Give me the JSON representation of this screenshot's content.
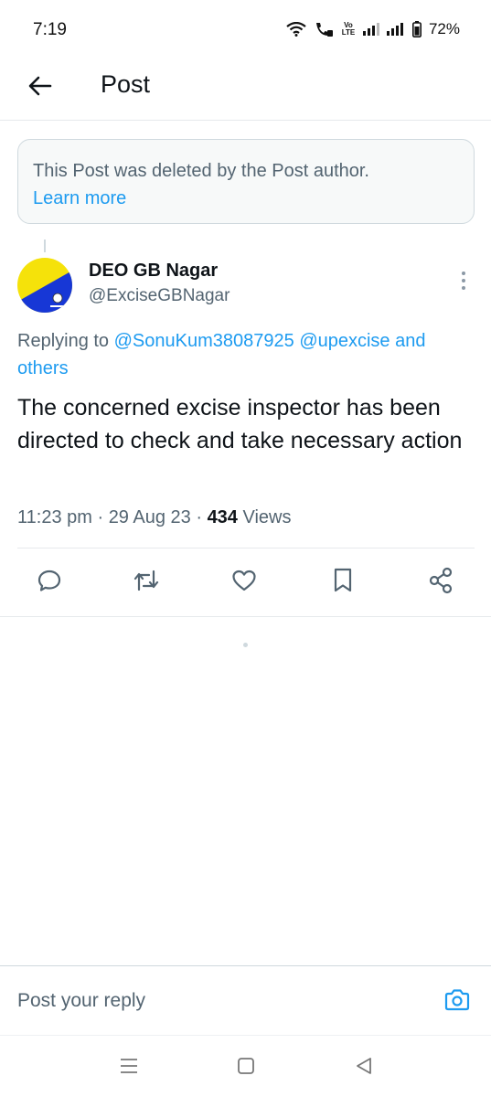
{
  "status_bar": {
    "time": "7:19",
    "volte_label": "Vo LTE",
    "battery": "72%"
  },
  "header": {
    "title": "Post"
  },
  "deleted_notice": {
    "message": "This Post was deleted by the Post author.",
    "link": "Learn more"
  },
  "tweet": {
    "author_name": "DEO GB Nagar",
    "author_handle": "@ExciseGBNagar",
    "replying_prefix": "Replying to ",
    "mentions": [
      "@SonuKum38087925",
      "@upexcise"
    ],
    "mention_joiner": " and",
    "others_label": "others",
    "text": "The concerned excise inspector has been directed to check and take necessary  action",
    "time": "11:23 pm",
    "date": "29 Aug 23",
    "views_count": "434",
    "views_label": "Views",
    "separator": " · "
  },
  "reply_bar": {
    "placeholder": "Post your reply"
  },
  "icons": {
    "back": "arrow-left-icon",
    "more": "more-vertical-icon",
    "reply": "comment-icon",
    "repost": "repost-icon",
    "like": "heart-icon",
    "bookmark": "bookmark-icon",
    "share": "share-icon",
    "camera": "camera-icon",
    "nav_recents": "menu-lines-icon",
    "nav_home": "square-icon",
    "nav_back": "triangle-back-icon"
  },
  "colors": {
    "accent": "#1d9bf0",
    "text": "#0f1419",
    "secondary_text": "#536471",
    "avatar_yellow": "#f5e20a",
    "avatar_blue": "#1737d6"
  }
}
